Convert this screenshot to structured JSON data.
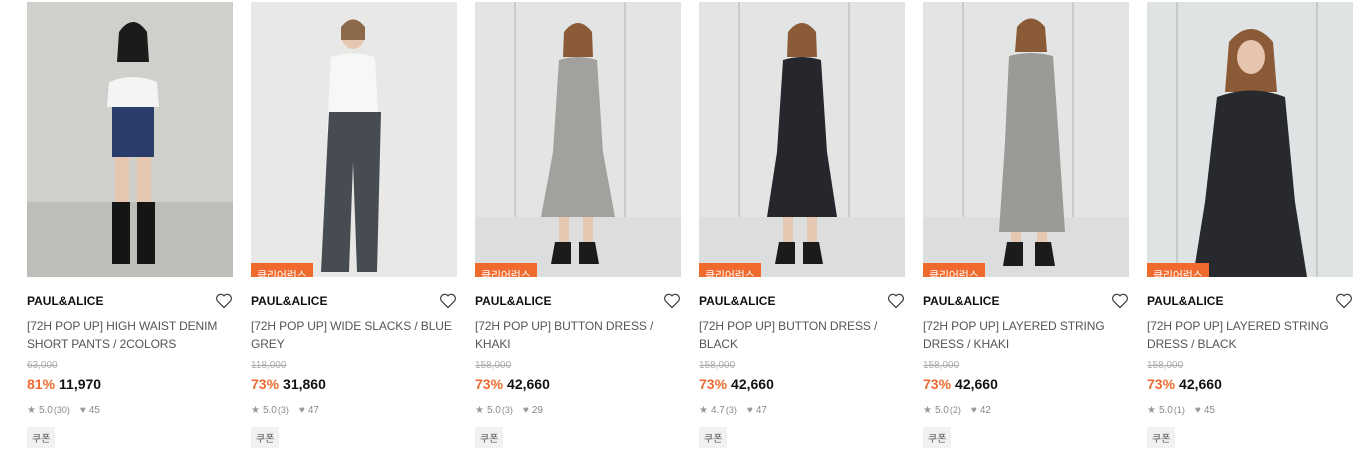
{
  "products": [
    {
      "brand": "PAUL&ALICE",
      "name": "[72H POP UP] HIGH WAIST DENIM SHORT PANTS / 2COLORS",
      "original_price": "63,000",
      "discount": "81%",
      "price": "11,970",
      "rating": "5.0",
      "reviews": "(30)",
      "likes": "45",
      "badge": "",
      "coupon": "쿠폰"
    },
    {
      "brand": "PAUL&ALICE",
      "name": "[72H POP UP] WIDE SLACKS / BLUE GREY",
      "original_price": "118,000",
      "discount": "73%",
      "price": "31,860",
      "rating": "5.0",
      "reviews": "(3)",
      "likes": "47",
      "badge": "클리어런스",
      "coupon": "쿠폰"
    },
    {
      "brand": "PAUL&ALICE",
      "name": "[72H POP UP] BUTTON DRESS / KHAKI",
      "original_price": "158,000",
      "discount": "73%",
      "price": "42,660",
      "rating": "5.0",
      "reviews": "(3)",
      "likes": "29",
      "badge": "클리어런스",
      "coupon": "쿠폰"
    },
    {
      "brand": "PAUL&ALICE",
      "name": "[72H POP UP] BUTTON DRESS / BLACK",
      "original_price": "158,000",
      "discount": "73%",
      "price": "42,660",
      "rating": "4.7",
      "reviews": "(3)",
      "likes": "47",
      "badge": "클리어런스",
      "coupon": "쿠폰"
    },
    {
      "brand": "PAUL&ALICE",
      "name": "[72H POP UP] LAYERED STRING DRESS / KHAKI",
      "original_price": "158,000",
      "discount": "73%",
      "price": "42,660",
      "rating": "5.0",
      "reviews": "(2)",
      "likes": "42",
      "badge": "클리어런스",
      "coupon": "쿠폰"
    },
    {
      "brand": "PAUL&ALICE",
      "name": "[72H POP UP] LAYERED STRING DRESS / BLACK",
      "original_price": "158,000",
      "discount": "73%",
      "price": "42,660",
      "rating": "5.0",
      "reviews": "(1)",
      "likes": "45",
      "badge": "클리어런스",
      "coupon": "쿠폰"
    }
  ],
  "colors": {
    "accent": "#f06a2e",
    "price": "#111111",
    "muted": "#888888"
  }
}
